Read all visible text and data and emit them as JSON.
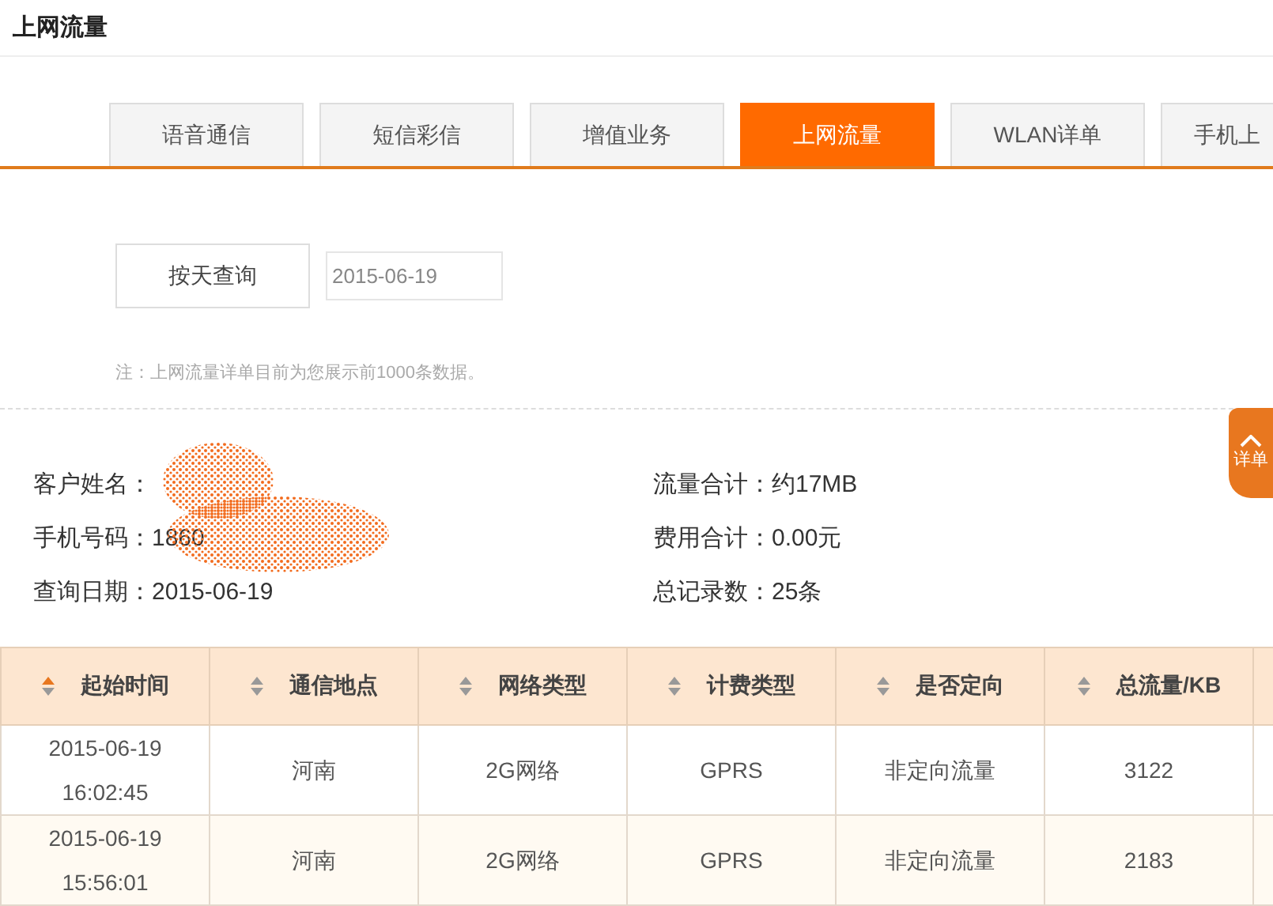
{
  "page_title": "上网流量",
  "tabs": [
    {
      "label": "语音通信",
      "selected": false
    },
    {
      "label": "短信彩信",
      "selected": false
    },
    {
      "label": "增值业务",
      "selected": false
    },
    {
      "label": "上网流量",
      "selected": true
    },
    {
      "label": "WLAN详单",
      "selected": false
    },
    {
      "label": "手机上",
      "selected": false
    }
  ],
  "query": {
    "button": "按天查询",
    "date": "2015-06-19",
    "note": "注：上网流量详单目前为您展示前1000条数据。"
  },
  "side_tab": {
    "label": "详单"
  },
  "summary_left": [
    {
      "text": "客户姓名：",
      "redacted": true
    },
    {
      "text": "手机号码：1860",
      "redacted": true
    },
    {
      "text": "查询日期：2015-06-19",
      "redacted": false
    }
  ],
  "summary_right": [
    {
      "text": "流量合计：约17MB"
    },
    {
      "text": "费用合计：0.00元"
    },
    {
      "text": "总记录数：25条"
    }
  ],
  "table": {
    "columns": [
      {
        "label": "起始时间",
        "sorted": true
      },
      {
        "label": "通信地点",
        "sorted": false
      },
      {
        "label": "网络类型",
        "sorted": false
      },
      {
        "label": "计费类型",
        "sorted": false
      },
      {
        "label": "是否定向",
        "sorted": false
      },
      {
        "label": "总流量/KB",
        "sorted": false
      }
    ],
    "rows": [
      [
        "2015-06-19 16:02:45",
        "河南",
        "2G网络",
        "GPRS",
        "非定向流量",
        "3122"
      ],
      [
        "2015-06-19 15:56:01",
        "河南",
        "2G网络",
        "GPRS",
        "非定向流量",
        "2183"
      ]
    ]
  }
}
